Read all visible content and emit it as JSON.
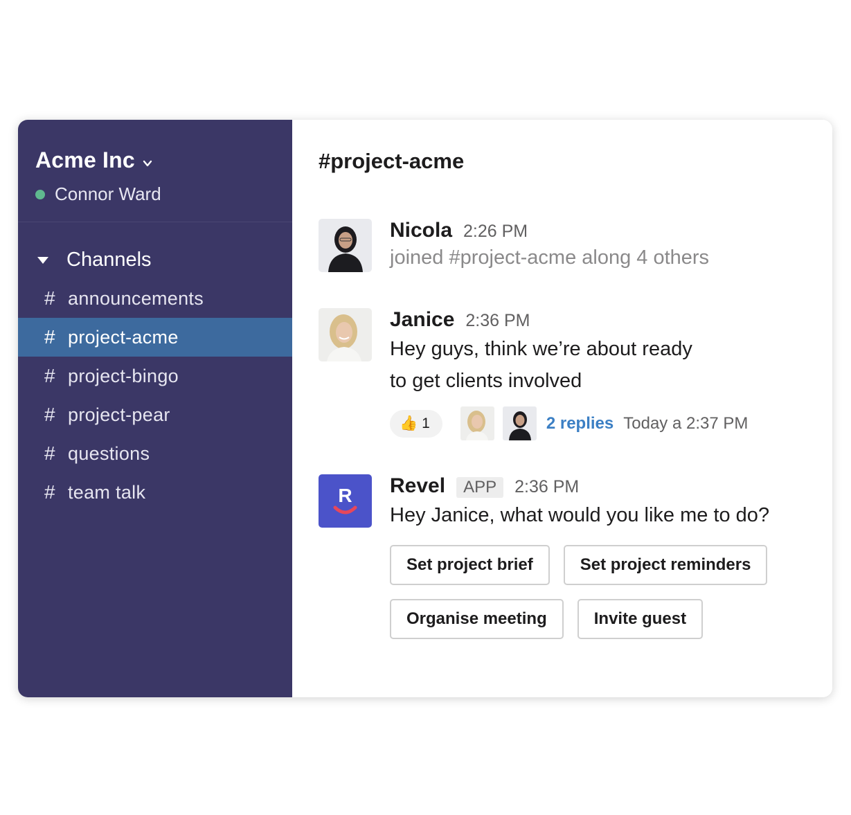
{
  "sidebar": {
    "workspace_name": "Acme Inc",
    "user_name": "Connor Ward",
    "channels_label": "Channels",
    "channels": [
      {
        "hash": "#",
        "name": "announcements"
      },
      {
        "hash": "#",
        "name": "project-acme"
      },
      {
        "hash": "#",
        "name": "project-bingo"
      },
      {
        "hash": "#",
        "name": "project-pear"
      },
      {
        "hash": "#",
        "name": "questions"
      },
      {
        "hash": "#",
        "name": "team talk"
      }
    ],
    "active_channel": "project-acme",
    "colors": {
      "background": "#3b3766",
      "active": "#3d6a9e",
      "presence": "#5fb98f"
    }
  },
  "main": {
    "channel_title": "#project-acme",
    "messages": [
      {
        "author": "Nicola",
        "time": "2:26 PM",
        "text": "joined #project-acme along 4 others"
      },
      {
        "author": "Janice",
        "time": "2:36 PM",
        "text_line1": "Hey guys, think we’re about ready",
        "text_line2": "to get clients involved",
        "reaction_emoji": "👍",
        "reaction_count": "1",
        "replies": "2 replies",
        "reply_time": "Today a 2:37 PM"
      },
      {
        "author": "Revel",
        "badge": "APP",
        "time": "2:36 PM",
        "text": "Hey Janice, what would you like me to do?",
        "logo_letter": "R",
        "actions": [
          "Set project brief",
          "Set project reminders",
          "Organise meeting",
          "Invite guest"
        ]
      }
    ],
    "colors": {
      "link": "#3b7fc4",
      "app_logo": "#4b53c9",
      "logo_smile": "#e8475a"
    }
  }
}
